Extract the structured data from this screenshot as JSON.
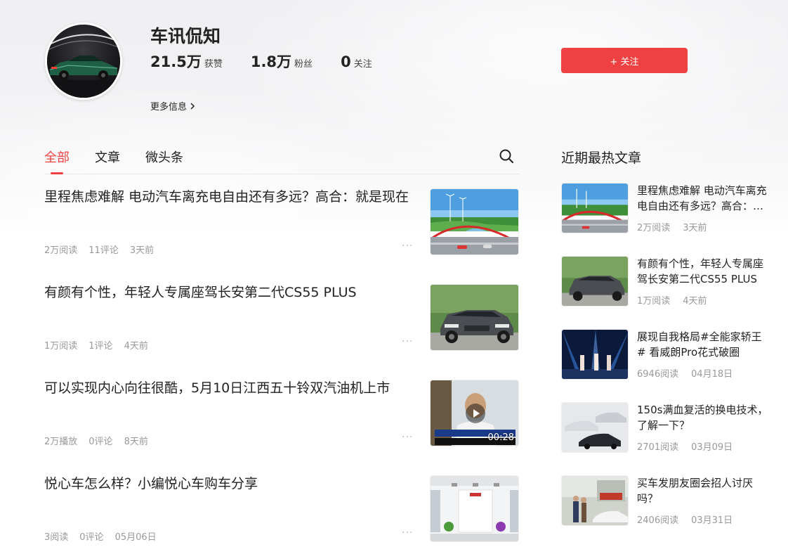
{
  "profile": {
    "name": "车讯侃知",
    "stats": [
      {
        "num": "21.5万",
        "label": "获赞"
      },
      {
        "num": "1.8万",
        "label": "粉丝"
      },
      {
        "num": "0",
        "label": "关注"
      }
    ],
    "more_info": "更多信息",
    "follow_label": "+ 关注"
  },
  "tabs": [
    {
      "label": "全部",
      "active": true
    },
    {
      "label": "文章",
      "active": false
    },
    {
      "label": "微头条",
      "active": false
    }
  ],
  "feed": [
    {
      "title": "里程焦虑难解 电动汽车离充电自由还有多远？高合：就是现在",
      "meta": [
        "2万阅读",
        "11评论",
        "3天前"
      ],
      "more": "···",
      "thumb": "bridge"
    },
    {
      "title": "有颜有个性，年轻人专属座驾长安第二代CS55 PLUS",
      "meta": [
        "1万阅读",
        "1评论",
        "4天前"
      ],
      "more": "···",
      "thumb": "suv"
    },
    {
      "title": "可以实现内心向往很酷，5月10日江西五十铃双汽油机上市",
      "meta": [
        "2万播放",
        "0评论",
        "8天前"
      ],
      "more": "···",
      "thumb": "video",
      "duration": "00:28"
    },
    {
      "title": "悦心车怎么样？小编悦心车购车分享",
      "meta": [
        "3阅读",
        "0评论",
        "05月06日"
      ],
      "more": "···",
      "thumb": "showroom"
    }
  ],
  "sidebar": {
    "title": "近期最热文章",
    "items": [
      {
        "title": "里程焦虑难解 电动汽车离充电自由还有多远？高合：就是现在",
        "meta": [
          "2万阅读",
          "3天前"
        ],
        "thumb": "bridge"
      },
      {
        "title": "有颜有个性，年轻人专属座驾长安第二代CS55 PLUS",
        "meta": [
          "1万阅读",
          "4天前"
        ],
        "thumb": "suv"
      },
      {
        "title": "展现自我格局#全能家轿王# 看威朗Pro花式破圈",
        "meta": [
          "6946阅读",
          "04月18日"
        ],
        "thumb": "stage"
      },
      {
        "title": "150s满血复活的换电技术，了解一下？",
        "meta": [
          "2701阅读",
          "03月09日"
        ],
        "thumb": "cars"
      },
      {
        "title": "买车发朋友圈会招人讨厌吗？",
        "meta": [
          "2406阅读",
          "03月31日"
        ],
        "thumb": "street"
      }
    ]
  },
  "colors": {
    "accent": "#f04142"
  }
}
